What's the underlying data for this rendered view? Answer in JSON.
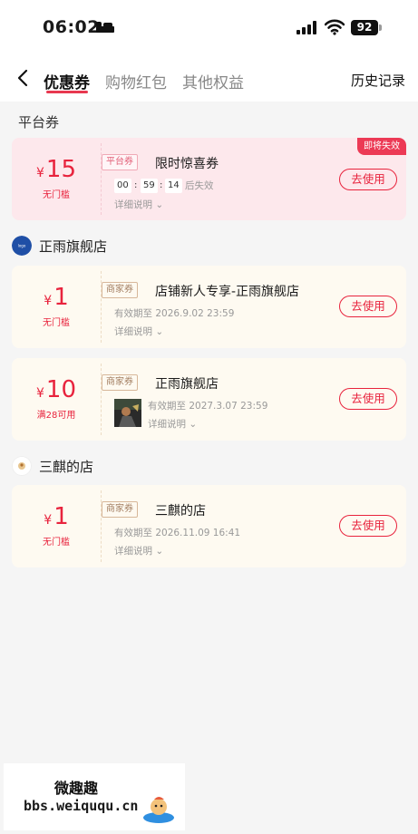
{
  "status_bar": {
    "time": "06:02",
    "battery": "92"
  },
  "nav": {
    "tabs": [
      {
        "label": "优惠券"
      },
      {
        "label": "购物红包"
      },
      {
        "label": "其他权益"
      }
    ],
    "history_label": "历史记录"
  },
  "platform_section": {
    "title": "平台券",
    "coupon": {
      "currency": "¥",
      "amount": "15",
      "condition": "无门槛",
      "tag": "平台券",
      "title": "限时惊喜券",
      "timer": {
        "h": "00",
        "m": "59",
        "s": "14"
      },
      "timer_suffix": "后失效",
      "detail": "详细说明",
      "badge": "即将失效",
      "button": "去使用"
    }
  },
  "shops": [
    {
      "name": "正雨旗舰店",
      "coupons": [
        {
          "currency": "¥",
          "amount": "1",
          "condition": "无门槛",
          "tag": "商家券",
          "title": "店铺新人专享-正雨旗舰店",
          "validity": "有效期至 2026.9.02 23:59",
          "detail": "详细说明",
          "button": "去使用"
        },
        {
          "currency": "¥",
          "amount": "10",
          "condition": "满28可用",
          "tag": "商家券",
          "title": "正雨旗舰店",
          "validity": "有效期至 2027.3.07 23:59",
          "detail": "详细说明",
          "button": "去使用"
        }
      ]
    },
    {
      "name": "三麒的店",
      "coupons": [
        {
          "currency": "¥",
          "amount": "1",
          "condition": "无门槛",
          "tag": "商家券",
          "title": "三麒的店",
          "validity": "有效期至 2026.11.09 16:41",
          "detail": "详细说明",
          "button": "去使用"
        }
      ]
    }
  ],
  "watermark": {
    "title": "微趣趣",
    "url": "bbs.weiququ.cn"
  },
  "colors": {
    "accent": "#e8233d",
    "platform_card": "#fde8ec",
    "shop_card": "#fefaf1",
    "badge": "#ec3a55"
  }
}
